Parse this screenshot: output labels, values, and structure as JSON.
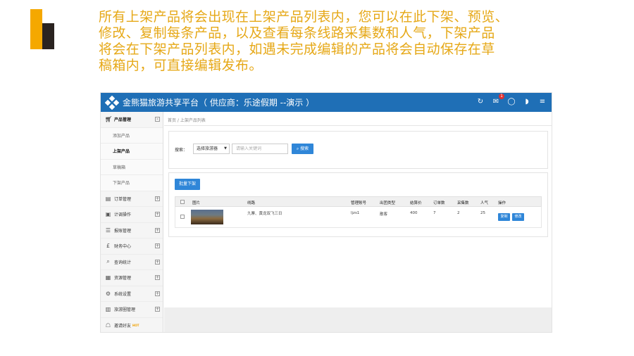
{
  "slide": {
    "text_lines": [
      "所有上架产品将会出现在上架产品列表内，您可以在此下架、预览、",
      "修改、复制每条产品，以及查看每条线路采集数和人气，下架产品",
      "将会在下架产品列表内，如遇未完成编辑的产品将会自动保存在草",
      "稿箱内，可直接编辑发布。"
    ],
    "colors": {
      "text": "#e6a817",
      "deco_gold": "#f5a800",
      "deco_dark": "#2a2320"
    }
  },
  "app": {
    "title": "金熊猫旅游共享平台（ 供应商：乐途假期 --演示 ）",
    "brand_color": "#1f6fb6",
    "top_icons": [
      "refresh-icon",
      "mail-icon",
      "chat-icon",
      "logout-icon",
      "menu-icon"
    ],
    "mail_badge": "1"
  },
  "sidebar": {
    "items": [
      {
        "label": "产品管理",
        "icon": "cart-icon",
        "type": "section",
        "expand": "-"
      },
      {
        "label": "添加产品",
        "type": "sub"
      },
      {
        "label": "上架产品",
        "type": "sub-active"
      },
      {
        "label": "草稿箱",
        "type": "sub"
      },
      {
        "label": "下架产品",
        "type": "sub"
      },
      {
        "label": "订单管理",
        "icon": "order-icon",
        "type": "section",
        "expand": "+"
      },
      {
        "label": "计调操作",
        "icon": "dispatch-icon",
        "type": "section",
        "expand": "+"
      },
      {
        "label": "报账管理",
        "icon": "report-icon",
        "type": "section",
        "expand": "+"
      },
      {
        "label": "财务中心",
        "icon": "finance-icon",
        "type": "section",
        "expand": "+"
      },
      {
        "label": "查询统计",
        "icon": "search-icon",
        "type": "section",
        "expand": "+"
      },
      {
        "label": "资源管理",
        "icon": "resource-icon",
        "type": "section",
        "expand": "+"
      },
      {
        "label": "系统设置",
        "icon": "gear-icon",
        "type": "section",
        "expand": "+"
      },
      {
        "label": "旅游圈管理",
        "icon": "circle-icon",
        "type": "section",
        "expand": "+"
      },
      {
        "label": "邀请好友",
        "icon": "gift-icon",
        "type": "section",
        "hot": "HOT"
      }
    ]
  },
  "content": {
    "breadcrumb": "首页 / 上架产品列表",
    "search": {
      "label": "搜索：",
      "select_value": "选择旅游器",
      "input_placeholder": "请输入关键词",
      "button_label": "搜索"
    },
    "list": {
      "batch_button": "批量下架",
      "columns": [
        "图片",
        "线路",
        "管理账号",
        "出团类型",
        "结算价",
        "订单数",
        "采集数",
        "人气",
        "操作"
      ],
      "rows": [
        {
          "route": "九寨、黄龙双飞三日",
          "account": "ljzs1",
          "group_type": "散客",
          "price": "400",
          "orders": "7",
          "collects": "2",
          "popularity": "25",
          "actions": [
            "复制",
            "修改"
          ]
        }
      ]
    }
  }
}
